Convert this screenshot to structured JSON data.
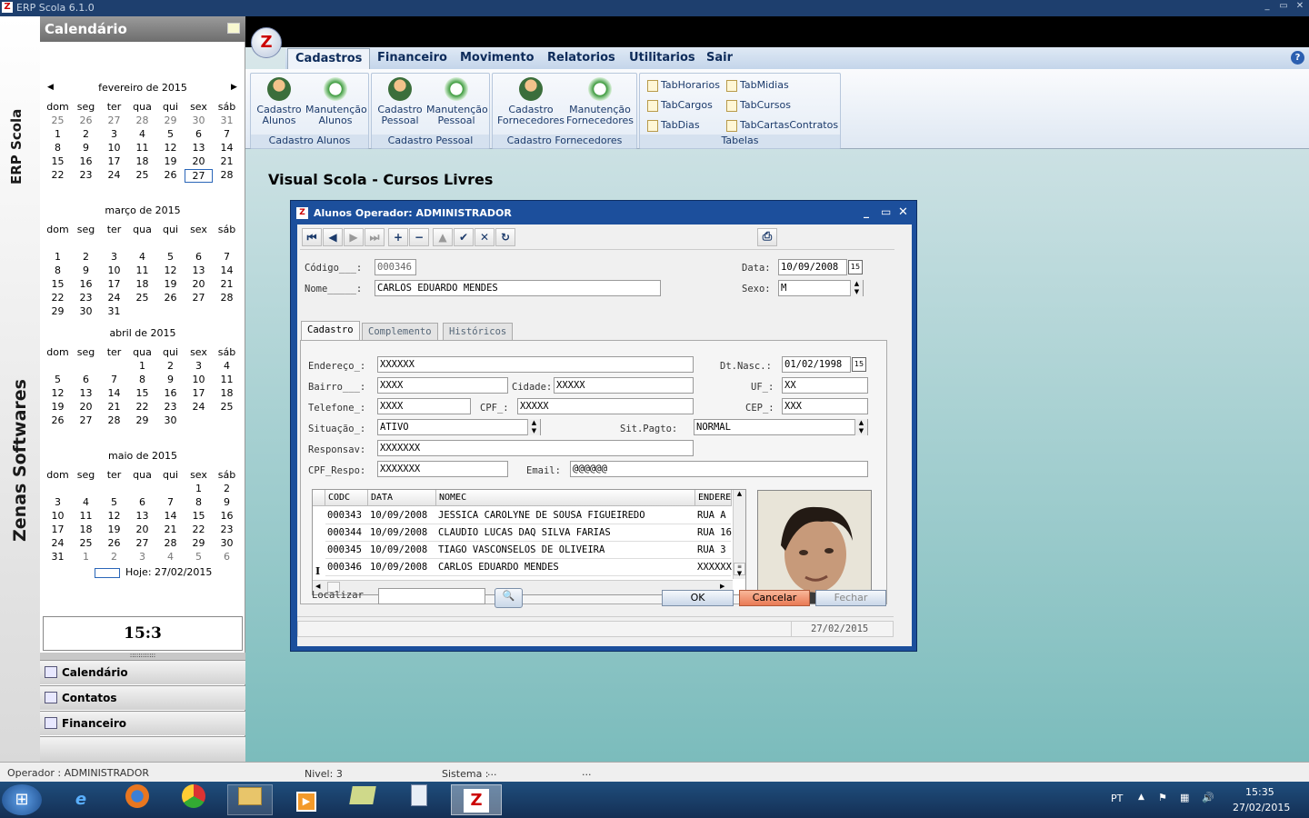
{
  "window": {
    "title": "ERP Scola 6.1.0"
  },
  "sidestrip": {
    "top_text": "ERP Scola",
    "bottom_text": "Zenas Softwares"
  },
  "calendar": {
    "header": "Calendário",
    "weekdays": [
      "dom",
      "seg",
      "ter",
      "qua",
      "qui",
      "sex",
      "sáb"
    ],
    "months": [
      {
        "title": "fevereiro de 2015",
        "weeks": [
          [
            "25",
            "26",
            "27",
            "28",
            "29",
            "30",
            "31"
          ],
          [
            "1",
            "2",
            "3",
            "4",
            "5",
            "6",
            "7"
          ],
          [
            "8",
            "9",
            "10",
            "11",
            "12",
            "13",
            "14"
          ],
          [
            "15",
            "16",
            "17",
            "18",
            "19",
            "20",
            "21"
          ],
          [
            "22",
            "23",
            "24",
            "25",
            "26",
            "27",
            "28"
          ]
        ]
      },
      {
        "title": "março de 2015",
        "weeks": [
          [
            "",
            "",
            "",
            "",
            "",
            "",
            ""
          ],
          [
            "1",
            "2",
            "3",
            "4",
            "5",
            "6",
            "7"
          ],
          [
            "8",
            "9",
            "10",
            "11",
            "12",
            "13",
            "14"
          ],
          [
            "15",
            "16",
            "17",
            "18",
            "19",
            "20",
            "21"
          ],
          [
            "22",
            "23",
            "24",
            "25",
            "26",
            "27",
            "28"
          ],
          [
            "29",
            "30",
            "31",
            "",
            "",
            "",
            ""
          ]
        ]
      },
      {
        "title": "abril de 2015",
        "weeks": [
          [
            "",
            "",
            "",
            "1",
            "2",
            "3",
            "4"
          ],
          [
            "5",
            "6",
            "7",
            "8",
            "9",
            "10",
            "11"
          ],
          [
            "12",
            "13",
            "14",
            "15",
            "16",
            "17",
            "18"
          ],
          [
            "19",
            "20",
            "21",
            "22",
            "23",
            "24",
            "25"
          ],
          [
            "26",
            "27",
            "28",
            "29",
            "30",
            "",
            ""
          ]
        ]
      },
      {
        "title": "maio de 2015",
        "weeks": [
          [
            "",
            "",
            "",
            "",
            "",
            "1",
            "2"
          ],
          [
            "3",
            "4",
            "5",
            "6",
            "7",
            "8",
            "9"
          ],
          [
            "10",
            "11",
            "12",
            "13",
            "14",
            "15",
            "16"
          ],
          [
            "17",
            "18",
            "19",
            "20",
            "21",
            "22",
            "23"
          ],
          [
            "24",
            "25",
            "26",
            "27",
            "28",
            "29",
            "30"
          ],
          [
            "31",
            "1",
            "2",
            "3",
            "4",
            "5",
            "6"
          ]
        ]
      }
    ],
    "today_label": "Hoje: 27/02/2015",
    "clock": "15:3"
  },
  "nav": {
    "items": [
      "Calendário",
      "Contatos",
      "Financeiro"
    ],
    "grip": "::::::::::::"
  },
  "menu": {
    "items": [
      "Cadastros",
      "Financeiro",
      "Movimento",
      "Relatorios",
      "Utilitarios",
      "Sair"
    ]
  },
  "ribbon": {
    "groups": [
      {
        "label": "Cadastro Alunos",
        "buttons": [
          "Cadastro\nAlunos",
          "Manutenção\nAlunos"
        ]
      },
      {
        "label": "Cadastro Pessoal",
        "buttons": [
          "Cadastro\nPessoal",
          "Manutenção\nPessoal"
        ]
      },
      {
        "label": "Cadastro Fornecedores",
        "buttons": [
          "Cadastro\nFornecedores",
          "Manutenção\nFornecedores"
        ]
      },
      {
        "label": "Tabelas",
        "small": [
          "TabHorarios",
          "TabMidias",
          "TabCargos",
          "TabCursos",
          "TabDias",
          "TabCartasContratos"
        ]
      }
    ]
  },
  "app_title": "Visual Scola - Cursos Livres",
  "dialog": {
    "title": "Alunos Operador: ADMINISTRADOR",
    "toolbar": [
      "⏮",
      "◀",
      "▶",
      "⏭",
      "+",
      "−",
      "▲",
      "✔",
      "✕",
      "↻"
    ],
    "fields": {
      "codigo_label": "Código___:",
      "codigo": "000346",
      "nome_label": "Nome_____:",
      "nome": "CARLOS EDUARDO MENDES",
      "data_label": "Data:",
      "data": "10/09/2008",
      "sexo_label": "Sexo:",
      "sexo": "M"
    },
    "tabs": [
      "Cadastro",
      "Complemento",
      "Históricos"
    ],
    "form": {
      "endereco_label": "Endereço_:",
      "endereco": "XXXXXX",
      "dtnasc_label": "Dt.Nasc.:",
      "dtnasc": "01/02/1998",
      "bairro_label": "Bairro___:",
      "bairro": "XXXX",
      "cidade_label": "Cidade:",
      "cidade": "XXXXX",
      "uf_label": "UF_:",
      "uf": "XX",
      "telefone_label": "Telefone_:",
      "telefone": "XXXX",
      "cpf_label": "CPF_:",
      "cpf": "XXXXX",
      "cep_label": "CEP_:",
      "cep": "XXX",
      "situacao_label": "Situação_:",
      "situacao": "ATIVO",
      "sitpagto_label": "Sit.Pagto:",
      "sitpagto": "NORMAL",
      "responsav_label": "Responsav:",
      "responsav": "XXXXXXX",
      "cpfresp_label": "CPF_Respo:",
      "cpfresp": "XXXXXXX",
      "email_label": "Email:",
      "email": "@@@@@@"
    },
    "grid": {
      "columns": [
        "CODC",
        "DATA",
        "NOMEC",
        "ENDERE"
      ],
      "rows": [
        [
          "000343",
          "10/09/2008",
          "JESSICA CAROLYNE DE SOUSA FIGUEIREDO",
          "RUA A"
        ],
        [
          "000344",
          "10/09/2008",
          "CLAUDIO LUCAS DAQ SILVA FARIAS",
          "RUA 16"
        ],
        [
          "000345",
          "10/09/2008",
          "TIAGO VASCONSELOS DE OLIVEIRA",
          "RUA 3"
        ],
        [
          "000346",
          "10/09/2008",
          "CARLOS EDUARDO MENDES",
          "XXXXXX"
        ]
      ],
      "current_marker": "I"
    },
    "localizar_label": "Localizar",
    "buttons": {
      "ok": "OK",
      "cancel": "Cancelar",
      "close": "Fechar"
    },
    "status_date": "27/02/2015"
  },
  "statusbar": {
    "operador": "Operador :  ADMINISTRADOR",
    "nivel": "Nivel:  3",
    "sistema": "Sistema :",
    "dots": "..."
  },
  "tray": {
    "lang": "PT",
    "time": "15:35",
    "date": "27/02/2015"
  },
  "colors": {
    "accent": "#1c4f9c",
    "cancel": "#f0906a"
  }
}
